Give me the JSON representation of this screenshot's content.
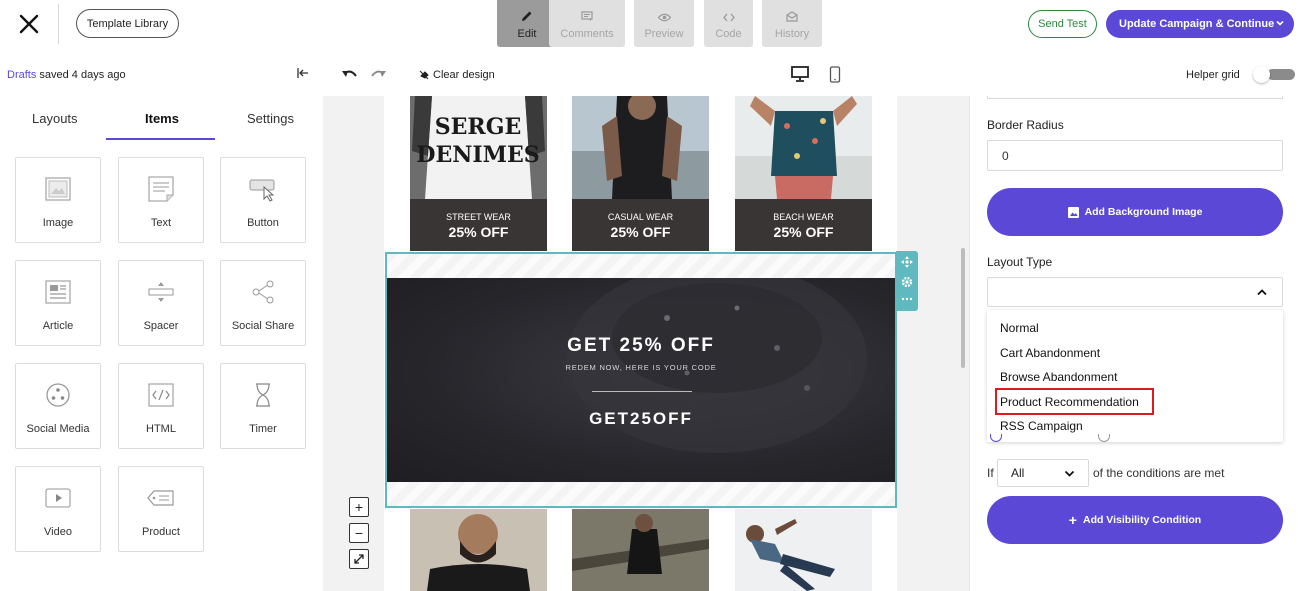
{
  "header": {
    "template_library": "Template Library",
    "modes": [
      {
        "label": "Edit",
        "icon": "pencil-icon",
        "active": true
      },
      {
        "label": "Comments",
        "icon": "comment-icon",
        "active": false
      },
      {
        "label": "Preview",
        "icon": "eye-icon",
        "active": false
      },
      {
        "label": "Code",
        "icon": "code-icon",
        "active": false
      },
      {
        "label": "History",
        "icon": "history-icon",
        "active": false
      }
    ],
    "send_test": "Send Test",
    "update_button": "Update Campaign & Continue"
  },
  "toolbar": {
    "drafts_link": "Drafts",
    "saved_text": " saved 4 days ago",
    "clear_design": "Clear design",
    "helper_grid": "Helper grid",
    "helper_grid_on": false
  },
  "left_panel": {
    "tabs": [
      "Layouts",
      "Items",
      "Settings"
    ],
    "active_tab": "Items",
    "items": [
      "Image",
      "Text",
      "Button",
      "Article",
      "Spacer",
      "Social Share",
      "Social Media",
      "HTML",
      "Timer",
      "Video",
      "Product"
    ]
  },
  "canvas": {
    "products": [
      {
        "name": "STREET WEAR",
        "offer": "25% OFF",
        "photo_text": "SERGE\nDENIMES"
      },
      {
        "name": "CASUAL WEAR",
        "offer": "25% OFF"
      },
      {
        "name": "BEACH WEAR",
        "offer": "25% OFF"
      }
    ],
    "promo_title": "GET 25% OFF",
    "promo_subtitle": "REDEM NOW, HERE IS YOUR CODE",
    "promo_code": "GET25OFF"
  },
  "right_panel": {
    "border_radius_label": "Border Radius",
    "border_radius_value": "0",
    "add_background_image": "Add Background Image",
    "layout_type_label": "Layout Type",
    "layout_options": [
      "Normal",
      "Cart Abandonment",
      "Browse Abandonment",
      "Product Recommendation",
      "RSS Campaign"
    ],
    "highlighted_option": "Product Recommendation",
    "condition_prefix": "If",
    "condition_value": "All",
    "condition_suffix": "of the conditions are met",
    "add_visibility_condition": "Add Visibility Condition"
  },
  "colors": {
    "accent": "#5b48d6",
    "send_test": "#2a8a3e",
    "selection": "#5fb9be",
    "highlight": "#e0191f"
  }
}
